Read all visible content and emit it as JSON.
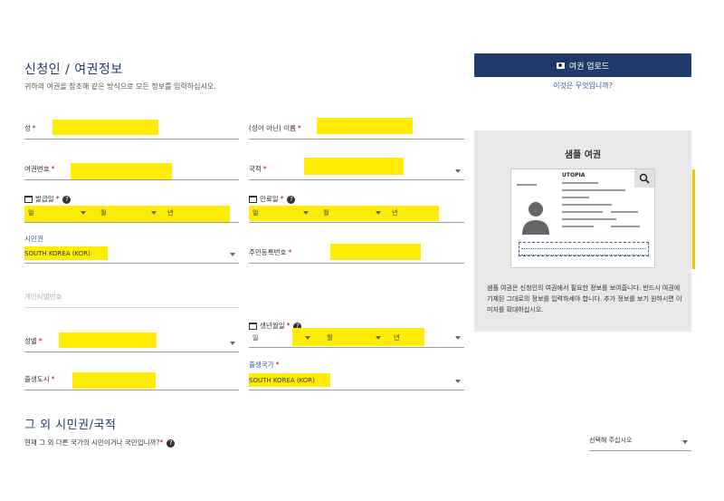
{
  "header": {
    "title": "신청인 / 여권정보",
    "subtitle": "귀하의 여권을 참조해 같은 방식으로 모든 정보를 입력하십시오."
  },
  "form": {
    "surname_label": "성",
    "given_name_label": "(성이 아닌) 이름",
    "passport_no_label": "여권번호",
    "nationality_label": "국적",
    "issue_date_label": "발급일",
    "expiry_date_label": "만료일",
    "date_day": "일",
    "date_month": "월",
    "date_year": "년",
    "citizenship_label": "시민권",
    "citizenship_value": "SOUTH KOREA (KOR)",
    "resident_no_label": "주민등록번호",
    "personal_id_placeholder": "개인식별번호",
    "gender_label": "성별",
    "birth_date_label": "생년월일",
    "birth_city_label": "출생도시",
    "birth_country_label": "출생국가",
    "birth_country_value": "SOUTH KOREA (KOR)",
    "required_mark": "*",
    "help_glyph": "?"
  },
  "sidebar": {
    "upload_button": "여권 업로드",
    "what_link": "이것은 무엇입니까?",
    "sample_title": "샘플 여권",
    "sample_passport_country": "UTOPIA",
    "sample_text": "샘플 여권은 신청인의 여권에서 필요한 정보를 보여줍니다. 반드시 여권에 기재된 그대로의 정보를 입력하세야 합니다. 추가 정보를 보기 원하시면 이미지를 확대하십시오."
  },
  "other_citizenship": {
    "title": "그 외 시민권/국적",
    "question": "현재 그 외 다른 국가의 시민이거나 국민입니까?",
    "select_placeholder": "선택해 주십시오"
  },
  "colors": {
    "brand": "#1f3a68",
    "highlight": "#ffec00",
    "link": "#2b5aa8"
  }
}
